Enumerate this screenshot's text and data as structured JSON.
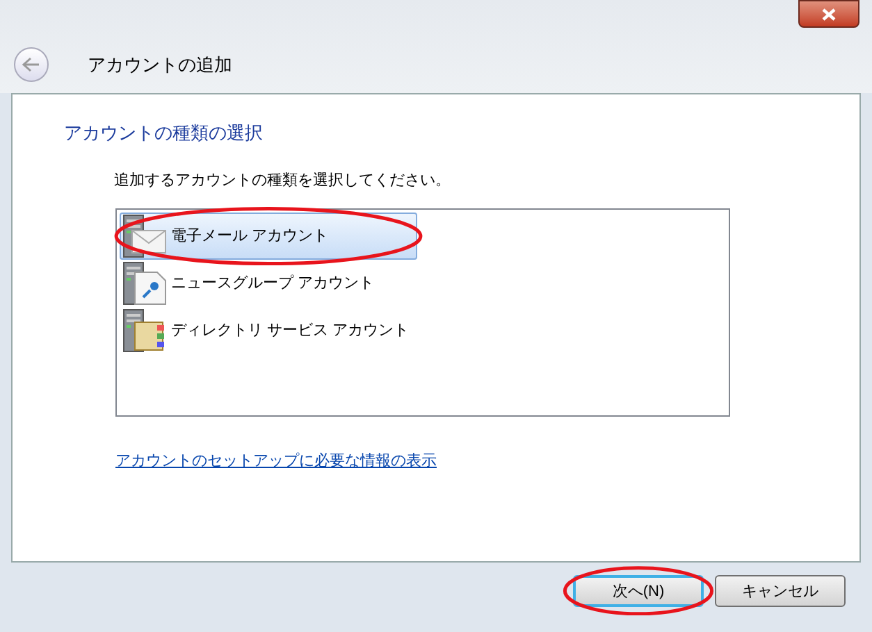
{
  "window": {
    "title": "アカウントの追加"
  },
  "heading": "アカウントの種類の選択",
  "instruction": "追加するアカウントの種類を選択してください。",
  "account_types": [
    {
      "label": "電子メール アカウント",
      "kind": "email",
      "selected": true,
      "circled": true
    },
    {
      "label": "ニュースグループ アカウント",
      "kind": "news",
      "selected": false,
      "circled": false
    },
    {
      "label": "ディレクトリ サービス アカウント",
      "kind": "directory",
      "selected": false,
      "circled": false
    }
  ],
  "link": "アカウントのセットアップに必要な情報の表示",
  "buttons": [
    {
      "label": "次へ(N)",
      "default": true,
      "circled": true
    },
    {
      "label": "キャンセル",
      "default": false,
      "circled": false
    }
  ]
}
